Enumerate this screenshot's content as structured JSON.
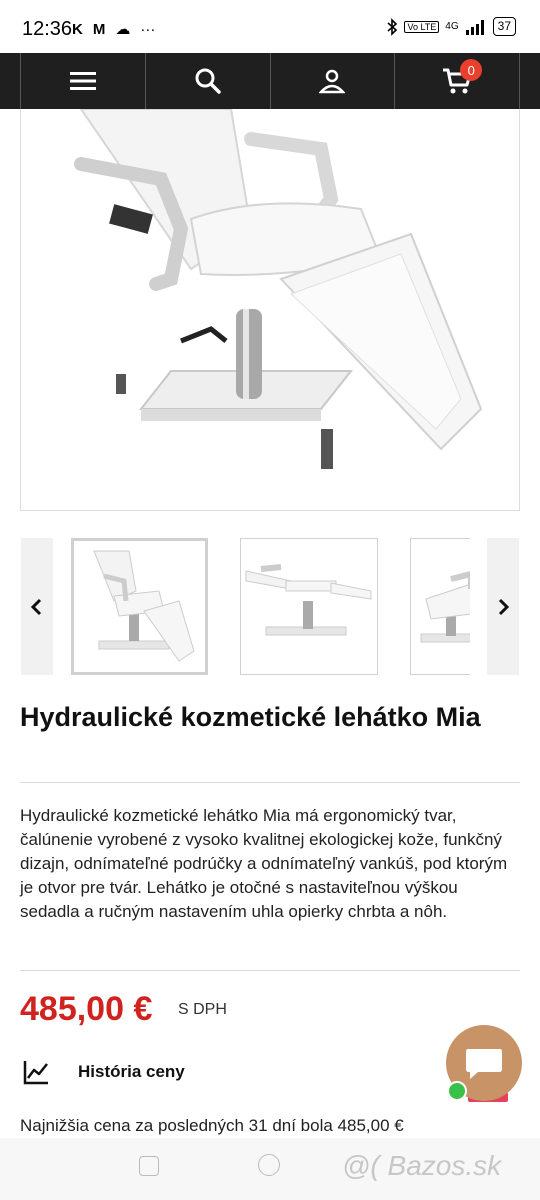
{
  "status_bar": {
    "time": "12:36",
    "left_icons": [
      "k-icon",
      "gmail-icon",
      "cloud-icon",
      "more-icon"
    ],
    "left_icon_glyphs": [
      "K",
      "M",
      "☁",
      "···"
    ],
    "network": "4G",
    "battery": "37"
  },
  "nav": {
    "items": [
      "menu-icon",
      "search-icon",
      "user-icon",
      "cart-icon"
    ],
    "cart_count": "0"
  },
  "product": {
    "title": "Hydraulické kozmetické lehátko Mia",
    "description": "Hydraulické kozmetické lehátko Mia má ergonomický tvar, čalúnenie vyrobené z vysoko kvalitnej ekologickej kože, funkčný dizajn, odnímateľné podrúčky a odnímateľný vankúš, pod ktorým je otvor pre tvár. Lehátko je otočné s nastaviteľnou výškou sedadla a ručným nastavením uhla opierky chrbta a nôh.",
    "price": "485,00 €",
    "vat_label": "S DPH",
    "history_label": "História ceny",
    "lowest_price_note": "Najnižšia cena za posledných 31 dní bola 485,00 €"
  },
  "watermark": "@( Bazos.sk",
  "colors": {
    "nav_bg": "#1f1f1f",
    "badge": "#e8402d",
    "price": "#d0231f",
    "chat": "#c89467"
  }
}
